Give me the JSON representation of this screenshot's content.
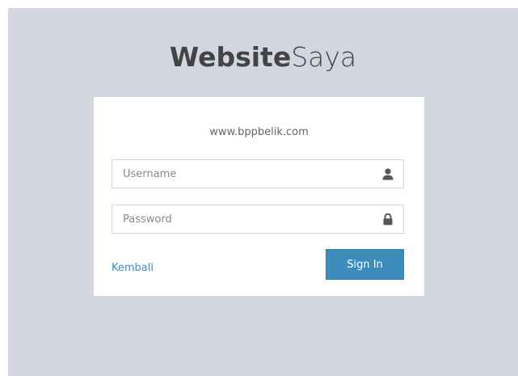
{
  "logo": {
    "bold": "Website",
    "light": "Saya"
  },
  "login_box": {
    "message": "www.bppbelik.com",
    "username": {
      "placeholder": "Username",
      "value": "",
      "icon": "user-icon"
    },
    "password": {
      "placeholder": "Password",
      "value": "",
      "icon": "lock-icon"
    },
    "back_link": "Kembali",
    "signin_label": "Sign In"
  },
  "colors": {
    "background": "#d2d6de",
    "box": "#ffffff",
    "accent": "#3c8dbc",
    "link": "#3c8dbc",
    "text": "#444444"
  }
}
